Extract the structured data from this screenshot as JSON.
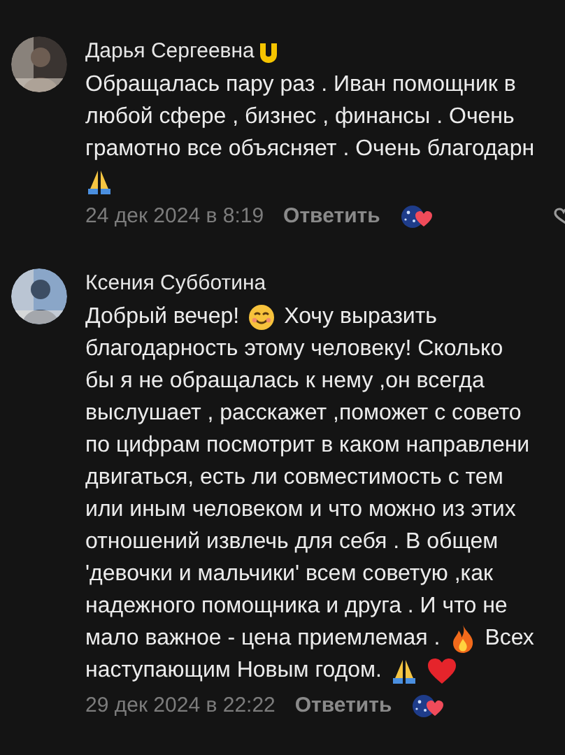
{
  "comments": [
    {
      "author": "Дарья Сергеевна",
      "author_badge": true,
      "lines": [
        [
          {
            "kind": "text",
            "text": "Обращалась пару раз . Иван помощник в"
          }
        ],
        [
          {
            "kind": "text",
            "text": "любой сфере , бизнес , финансы . Очень"
          }
        ],
        [
          {
            "kind": "text",
            "text": "грамотно все объясняет . Очень благодарн"
          }
        ],
        [
          {
            "kind": "pray"
          }
        ]
      ],
      "date": "24 дек 2024 в 8:19",
      "reply": "Ответить",
      "like_visible": true
    },
    {
      "author": "Ксения Субботина",
      "author_badge": false,
      "lines": [
        [
          {
            "kind": "text",
            "text": "Добрый вечер!"
          },
          {
            "kind": "smile"
          },
          {
            "kind": "text",
            "text": "Хочу выразить"
          }
        ],
        [
          {
            "kind": "text",
            "text": "благодарность этому человеку!  Сколько"
          }
        ],
        [
          {
            "kind": "text",
            "text": "бы я не обращалась к нему ,он всегда"
          }
        ],
        [
          {
            "kind": "text",
            "text": "выслушает , расскажет ,поможет с совето"
          }
        ],
        [
          {
            "kind": "text",
            "text": "по цифрам посмотрит в каком направлени"
          }
        ],
        [
          {
            "kind": "text",
            "text": "двигаться, есть ли совместимость с тем"
          }
        ],
        [
          {
            "kind": "text",
            "text": "или иным человеком и что можно из этих"
          }
        ],
        [
          {
            "kind": "text",
            "text": "отношений извлечь для себя . В общем"
          }
        ],
        [
          {
            "kind": "text",
            "text": "'девочки и мальчики' всем советую ,как"
          }
        ],
        [
          {
            "kind": "text",
            "text": "надежного помощника и друга . И что не"
          }
        ],
        [
          {
            "kind": "text",
            "text": "мало важное - цена приемлемая ."
          },
          {
            "kind": "fire"
          },
          {
            "kind": "text",
            "text": "Всех"
          }
        ],
        [
          {
            "kind": "text",
            "text": "наступающим Новым годом."
          },
          {
            "kind": "pray"
          },
          {
            "kind": "heart"
          }
        ]
      ],
      "date": "29 дек 2024 в 22:22",
      "reply": "Ответить",
      "like_visible": false
    }
  ]
}
